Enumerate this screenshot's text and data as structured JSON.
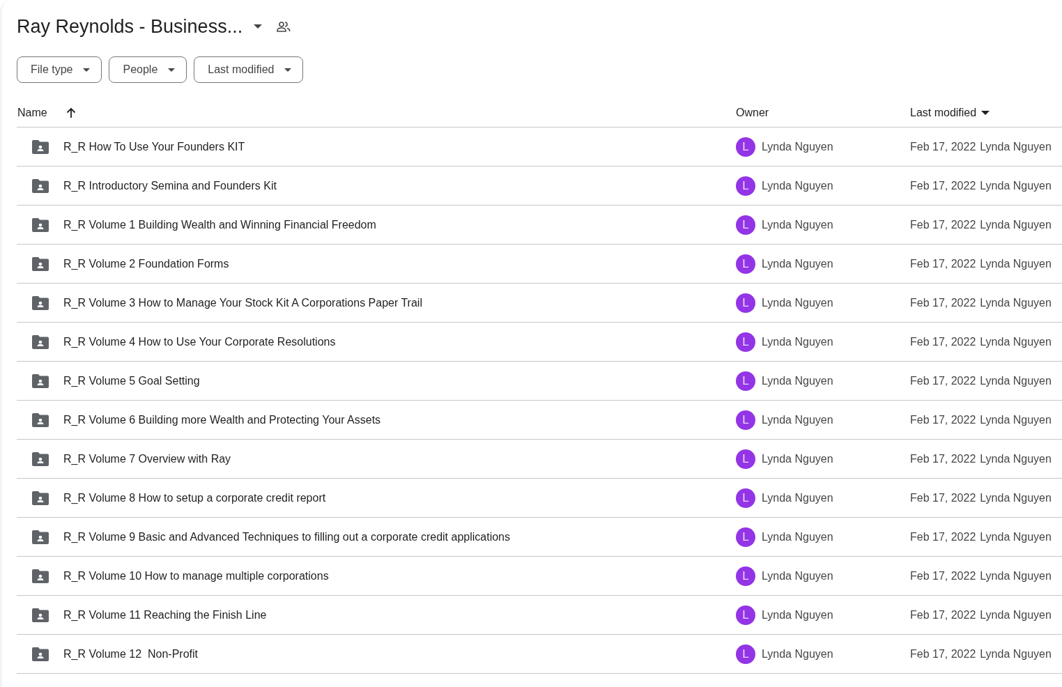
{
  "folder_title": "Ray Reynolds - Business...",
  "filters": [
    "File type",
    "People",
    "Last modified"
  ],
  "table": {
    "columns": [
      "Name",
      "Owner",
      "Last modified"
    ],
    "rows": [
      {
        "name": "R_R How To Use Your Founders KIT",
        "owner_initial": "L",
        "owner": "Lynda Nguyen",
        "modified_date": "Feb 17, 2022",
        "modified_by": "Lynda Nguyen"
      },
      {
        "name": "R_R Introductory Semina and Founders Kit",
        "owner_initial": "L",
        "owner": "Lynda Nguyen",
        "modified_date": "Feb 17, 2022",
        "modified_by": "Lynda Nguyen"
      },
      {
        "name": "R_R Volume 1 Building Wealth and Winning Financial Freedom",
        "owner_initial": "L",
        "owner": "Lynda Nguyen",
        "modified_date": "Feb 17, 2022",
        "modified_by": "Lynda Nguyen"
      },
      {
        "name": "R_R Volume 2 Foundation Forms",
        "owner_initial": "L",
        "owner": "Lynda Nguyen",
        "modified_date": "Feb 17, 2022",
        "modified_by": "Lynda Nguyen"
      },
      {
        "name": "R_R Volume 3 How to Manage Your Stock Kit A Corporations Paper Trail",
        "owner_initial": "L",
        "owner": "Lynda Nguyen",
        "modified_date": "Feb 17, 2022",
        "modified_by": "Lynda Nguyen"
      },
      {
        "name": "R_R Volume 4 How to Use Your Corporate Resolutions",
        "owner_initial": "L",
        "owner": "Lynda Nguyen",
        "modified_date": "Feb 17, 2022",
        "modified_by": "Lynda Nguyen"
      },
      {
        "name": "R_R Volume 5 Goal Setting",
        "owner_initial": "L",
        "owner": "Lynda Nguyen",
        "modified_date": "Feb 17, 2022",
        "modified_by": "Lynda Nguyen"
      },
      {
        "name": "R_R Volume 6 Building more Wealth and Protecting Your Assets",
        "owner_initial": "L",
        "owner": "Lynda Nguyen",
        "modified_date": "Feb 17, 2022",
        "modified_by": "Lynda Nguyen"
      },
      {
        "name": "R_R Volume 7 Overview with Ray",
        "owner_initial": "L",
        "owner": "Lynda Nguyen",
        "modified_date": "Feb 17, 2022",
        "modified_by": "Lynda Nguyen"
      },
      {
        "name": "R_R Volume 8 How to setup a corporate credit report",
        "owner_initial": "L",
        "owner": "Lynda Nguyen",
        "modified_date": "Feb 17, 2022",
        "modified_by": "Lynda Nguyen"
      },
      {
        "name": "R_R Volume 9 Basic and Advanced Techniques to filling out a corporate credit applications",
        "owner_initial": "L",
        "owner": "Lynda Nguyen",
        "modified_date": "Feb 17, 2022",
        "modified_by": "Lynda Nguyen"
      },
      {
        "name": "R_R Volume 10 How to manage multiple corporations",
        "owner_initial": "L",
        "owner": "Lynda Nguyen",
        "modified_date": "Feb 17, 2022",
        "modified_by": "Lynda Nguyen"
      },
      {
        "name": "R_R Volume 11 Reaching the Finish Line",
        "owner_initial": "L",
        "owner": "Lynda Nguyen",
        "modified_date": "Feb 17, 2022",
        "modified_by": "Lynda Nguyen"
      },
      {
        "name": "R_R Volume 12  Non-Profit",
        "owner_initial": "L",
        "owner": "Lynda Nguyen",
        "modified_date": "Feb 17, 2022",
        "modified_by": "Lynda Nguyen"
      }
    ]
  }
}
